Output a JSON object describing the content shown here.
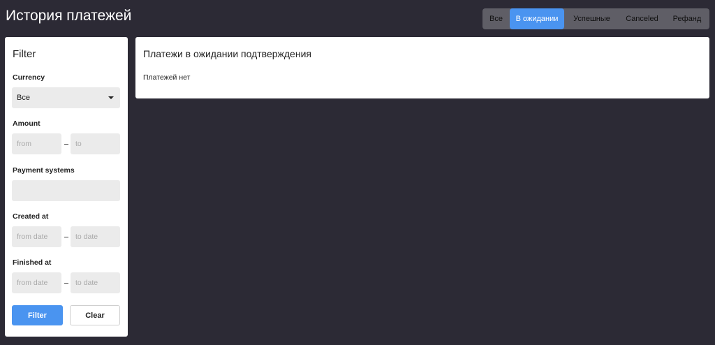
{
  "header": {
    "title": "История платежей"
  },
  "tabs": [
    {
      "label": "Все",
      "active": false
    },
    {
      "label": "В ожидании",
      "active": true
    },
    {
      "label": "Успешные",
      "active": false
    },
    {
      "label": "Canceled",
      "active": false
    },
    {
      "label": "Рефанд",
      "active": false
    }
  ],
  "filter": {
    "title": "Filter",
    "currency": {
      "label": "Currency",
      "value": "Все"
    },
    "amount": {
      "label": "Amount",
      "from_placeholder": "from",
      "to_placeholder": "to"
    },
    "payment_systems": {
      "label": "Payment systems",
      "value": ""
    },
    "created_at": {
      "label": "Created at",
      "from_placeholder": "from date",
      "to_placeholder": "to date"
    },
    "finished_at": {
      "label": "Finished at",
      "from_placeholder": "from date",
      "to_placeholder": "to date"
    },
    "filter_button": "Filter",
    "clear_button": "Clear"
  },
  "main": {
    "heading": "Платежи в ожидании подтверждения",
    "empty_text": "Платежей нет"
  },
  "colors": {
    "background": "#2c2a35",
    "accent": "#4a94f0",
    "tab_bar": "#5f5e66",
    "input_bg": "#ebebeb"
  }
}
